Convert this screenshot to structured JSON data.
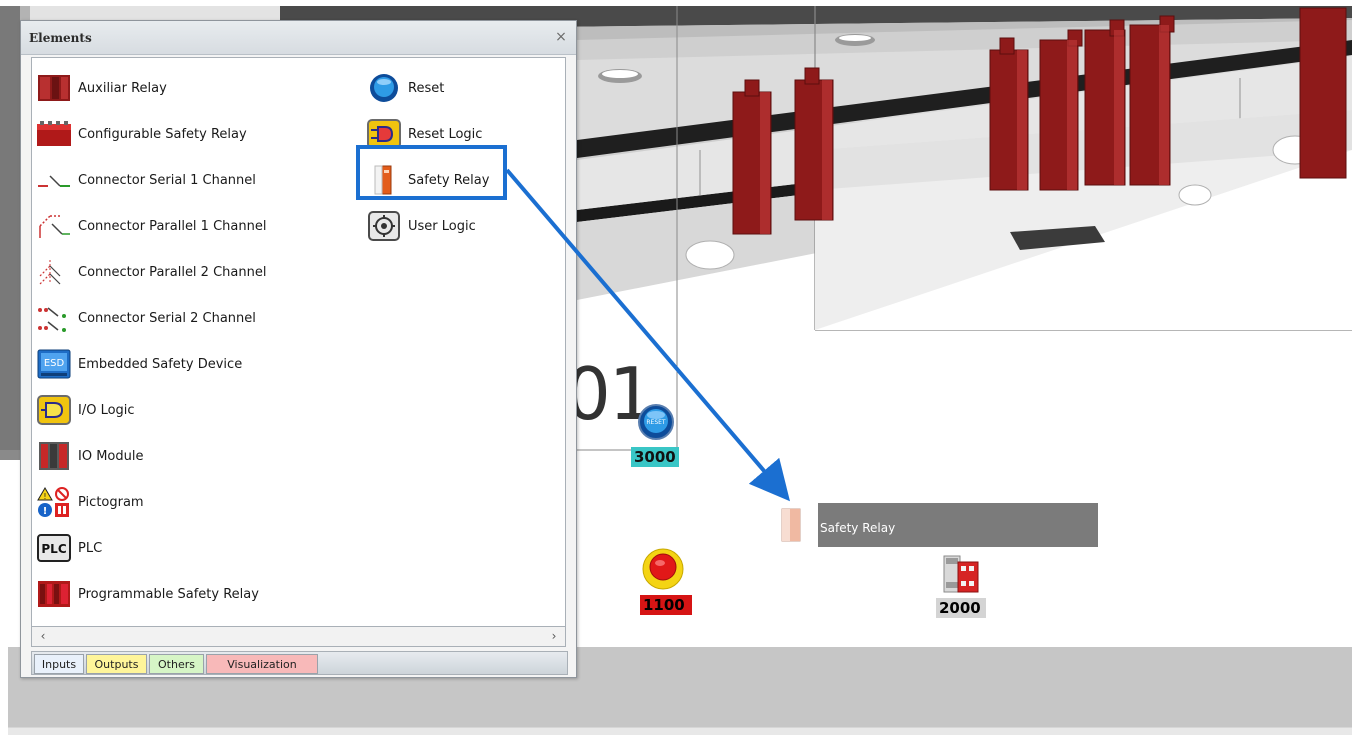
{
  "panel": {
    "title": "Elements",
    "close_glyph": "×",
    "items_left": [
      {
        "label": "Auxiliar Relay",
        "icon": "auxiliar-relay-icon"
      },
      {
        "label": "Configurable Safety Relay",
        "icon": "configurable-safety-relay-icon"
      },
      {
        "label": "Connector  Serial 1 Channel",
        "icon": "connector-serial-1-icon"
      },
      {
        "label": "Connector Parallel 1 Channel",
        "icon": "connector-parallel-1-icon"
      },
      {
        "label": "Connector Parallel 2 Channel",
        "icon": "connector-parallel-2-icon"
      },
      {
        "label": "Connector Serial 2 Channel",
        "icon": "connector-serial-2-icon"
      },
      {
        "label": "Embedded Safety Device",
        "icon": "embedded-safety-device-icon"
      },
      {
        "label": "I/O Logic",
        "icon": "io-logic-icon"
      },
      {
        "label": "IO Module",
        "icon": "io-module-icon"
      },
      {
        "label": "Pictogram",
        "icon": "pictogram-icon"
      },
      {
        "label": "PLC",
        "icon": "plc-icon"
      },
      {
        "label": "Programmable Safety Relay",
        "icon": "programmable-safety-relay-icon"
      }
    ],
    "items_right": [
      {
        "label": "Reset",
        "icon": "reset-icon"
      },
      {
        "label": "Reset Logic",
        "icon": "reset-logic-icon"
      },
      {
        "label": "Safety Relay",
        "icon": "safety-relay-icon"
      },
      {
        "label": "User Logic",
        "icon": "user-logic-icon"
      }
    ],
    "tabs": [
      {
        "label": "Inputs",
        "color": "#e9f1fb"
      },
      {
        "label": "Outputs",
        "color": "#fff59a"
      },
      {
        "label": "Others",
        "color": "#d6f5c6"
      },
      {
        "label": "Visualization",
        "color": "#f8b9b9"
      }
    ],
    "icon_text": {
      "esd": "ESD",
      "plc": "PLC",
      "reset": "RESET"
    }
  },
  "canvas": {
    "dropped_label": "Safety Relay",
    "reset_tag": "3000",
    "estop_tag": "1100",
    "contactor_tag": "2000",
    "big_number": "01"
  },
  "colors": {
    "highlight": "#1b6fd1",
    "relay_red": "#8e1a1a",
    "reset_tag_bg": "#39c6c6",
    "estop_tag_bg": "#d61414"
  }
}
